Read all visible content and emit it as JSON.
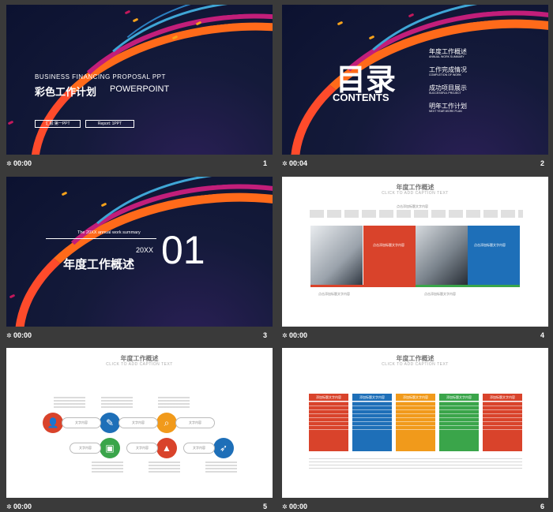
{
  "slides": [
    {
      "number": "1",
      "time": "00:00",
      "title_en": "BUSINESS FINANCING PROPOSAL PPT",
      "title_cn": "彩色工作计划",
      "title_en2": "POWERPOINT",
      "btn1": "汇报:第一PPT",
      "btn2": "Report: 1PPT"
    },
    {
      "number": "2",
      "time": "00:04",
      "title_cn": "目录",
      "title_en": "CONTENTS",
      "items": [
        {
          "cn": "年度工作概述",
          "en": "ANNUAL WORK SUMMARY"
        },
        {
          "cn": "工作完成情况",
          "en": "COMPLETION OF WORK"
        },
        {
          "cn": "成功项目展示",
          "en": "SUCCESSFUL PROJECT"
        },
        {
          "cn": "明年工作计划",
          "en": "NEXT YEAR WORK PLAN"
        }
      ]
    },
    {
      "number": "3",
      "time": "00:00",
      "subtitle": "The 20XX annual work summary",
      "year": "20XX",
      "title_cn": "年度工作概述",
      "big_num": "01"
    },
    {
      "number": "4",
      "time": "00:00",
      "title": "年度工作概述",
      "sub": "CLICK TO ADD CAPTION TEXT",
      "caption": "点击添加标题文字内容",
      "box1": "点击添加标题文字内容",
      "box2": "点击添加标题文字内容"
    },
    {
      "number": "5",
      "time": "00:00",
      "title": "年度工作概述",
      "sub": "CLICK TO ADD CAPTION TEXT",
      "pill": "文字内容"
    },
    {
      "number": "6",
      "time": "00:00",
      "title": "年度工作概述",
      "sub": "CLICK TO ADD CAPTION TEXT",
      "col_head": "添加标题文字内容"
    }
  ],
  "colors": {
    "red": "#d9432b",
    "blue": "#1e6fb8",
    "orange": "#f19a1b",
    "green": "#3aa54a"
  },
  "icons": [
    "star-icon",
    "user-icon",
    "pen-icon",
    "search-icon",
    "bag-icon",
    "cone-icon",
    "rocket-icon"
  ]
}
